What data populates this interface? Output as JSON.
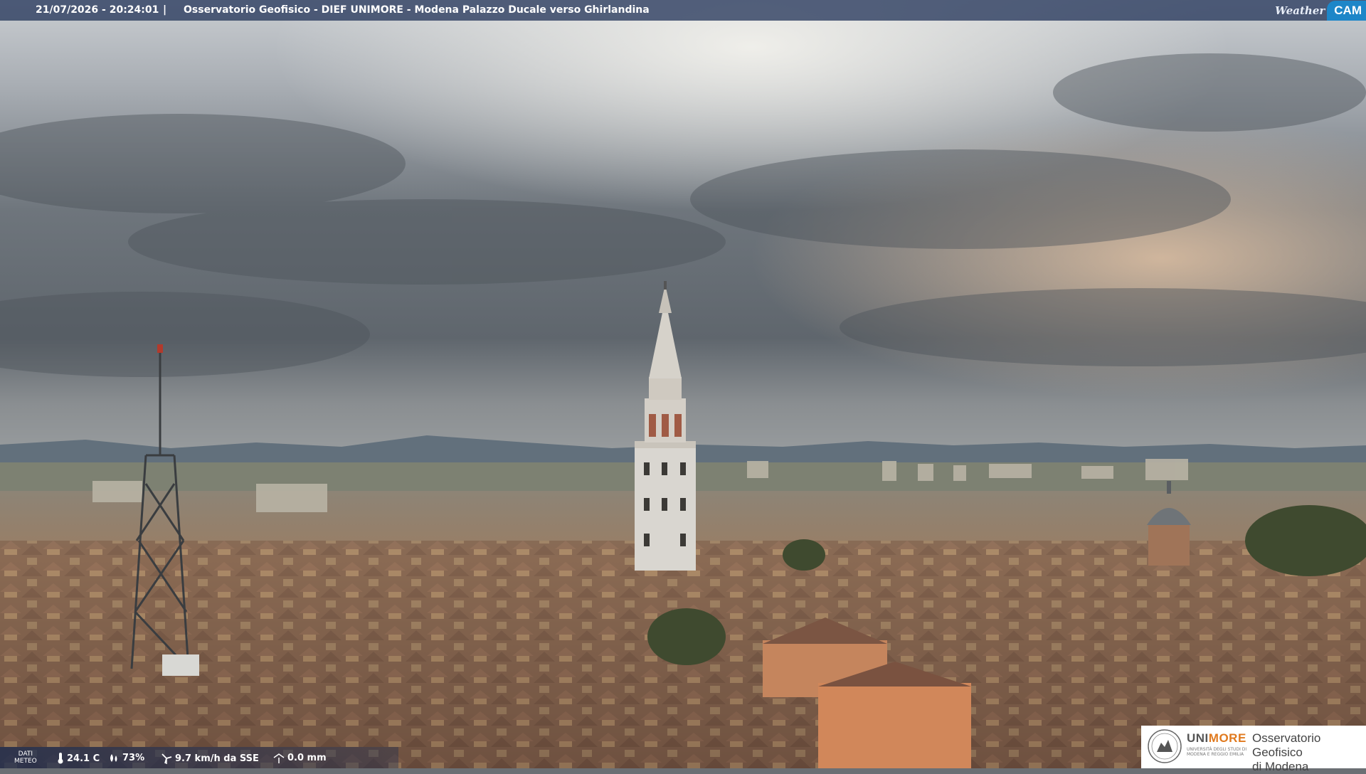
{
  "overlay": {
    "timestamp": "21/07/2026 - 20:24:01",
    "separator": "|",
    "camera_title": "Osservatorio Geofisico - DIEF UNIMORE - Modena Palazzo Ducale verso Ghirlandina",
    "weathercam_brand": {
      "weather": "Weather",
      "cam": "CAM"
    }
  },
  "meteo": {
    "label_line1": "DATI",
    "label_line2": "METEO",
    "temperature": "24.1 C",
    "humidity": "73%",
    "wind": "9.7 km/h da SSE",
    "rain": "0.0 mm"
  },
  "logo": {
    "uni": "UNI",
    "more": "MORE",
    "subtitle_line1": "UNIVERSITÀ DEGLI STUDI DI",
    "subtitle_line2": "MODENA E REGGIO EMILIA",
    "observatory_line1": "Osservatorio Geofisico",
    "observatory_line2": "di Modena"
  },
  "colors": {
    "overlay_bar": "#28385c",
    "brand_blue": "#1d86c8",
    "unimore_orange": "#e07a1f"
  }
}
